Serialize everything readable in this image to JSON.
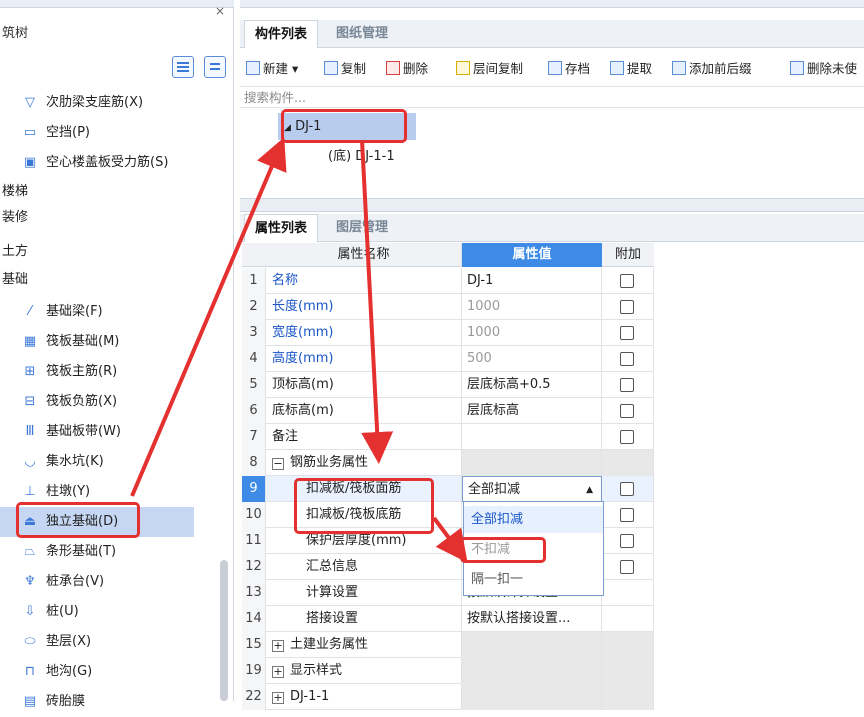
{
  "left_panel": {
    "title": "筑树",
    "items": [
      {
        "label": "次肋梁支座筋(X)",
        "icon": "rib-beam-support-icon"
      },
      {
        "label": "空挡(P)",
        "icon": "void-icon"
      },
      {
        "label": "空心楼盖板受力筋(S)",
        "icon": "hollow-slab-rebar-icon"
      }
    ],
    "categories": {
      "stairs": "楼梯",
      "decoration": "装修",
      "earthwork": "土方",
      "foundation": "基础"
    },
    "foundation_items": [
      {
        "label": "基础梁(F)",
        "icon": "foundation-beam-icon"
      },
      {
        "label": "筏板基础(M)",
        "icon": "raft-foundation-icon"
      },
      {
        "label": "筏板主筋(R)",
        "icon": "raft-main-rebar-icon"
      },
      {
        "label": "筏板负筋(X)",
        "icon": "raft-negative-rebar-icon"
      },
      {
        "label": "基础板带(W)",
        "icon": "foundation-strip-icon"
      },
      {
        "label": "集水坑(K)",
        "icon": "sump-pit-icon"
      },
      {
        "label": "柱墩(Y)",
        "icon": "column-pier-icon"
      },
      {
        "label": "独立基础(D)",
        "icon": "isolated-footing-icon"
      },
      {
        "label": "条形基础(T)",
        "icon": "strip-footing-icon"
      },
      {
        "label": "桩承台(V)",
        "icon": "pile-cap-icon"
      },
      {
        "label": "桩(U)",
        "icon": "pile-icon"
      },
      {
        "label": "垫层(X)",
        "icon": "cushion-layer-icon"
      },
      {
        "label": "地沟(G)",
        "icon": "trench-icon"
      },
      {
        "label": "砖胎膜",
        "icon": "brick-mould-icon"
      }
    ]
  },
  "component_panel": {
    "tabs": [
      "构件列表",
      "图纸管理"
    ],
    "toolbar": [
      "新建",
      "复制",
      "删除",
      "层间复制",
      "存档",
      "提取",
      "添加前后缀",
      "删除未使"
    ],
    "search_placeholder": "搜索构件...",
    "tree": {
      "root": "DJ-1",
      "child_prefix": "(底)",
      "child": "DJ-1-1"
    }
  },
  "property_panel": {
    "tabs": [
      "属性列表",
      "图层管理"
    ],
    "headers": {
      "name": "属性名称",
      "value": "属性值",
      "extra": "附加"
    },
    "rows": [
      {
        "num": "1",
        "name": "名称",
        "value": "DJ-1"
      },
      {
        "num": "2",
        "name": "长度(mm)",
        "value": "1000"
      },
      {
        "num": "3",
        "name": "宽度(mm)",
        "value": "1000"
      },
      {
        "num": "4",
        "name": "高度(mm)",
        "value": "500"
      },
      {
        "num": "5",
        "name": "顶标高(m)",
        "value": "层底标高+0.5"
      },
      {
        "num": "6",
        "name": "底标高(m)",
        "value": "层底标高"
      },
      {
        "num": "7",
        "name": "备注",
        "value": ""
      },
      {
        "num": "8",
        "name": "钢筋业务属性",
        "value": ""
      },
      {
        "num": "9",
        "name": "扣减板/筏板面筋",
        "value": "全部扣减"
      },
      {
        "num": "10",
        "name": "扣减板/筏板底筋",
        "value": ""
      },
      {
        "num": "11",
        "name": "保护层厚度(mm)",
        "value": ""
      },
      {
        "num": "12",
        "name": "汇总信息",
        "value": ""
      },
      {
        "num": "13",
        "name": "计算设置",
        "value": "按默认计算设置..."
      },
      {
        "num": "14",
        "name": "搭接设置",
        "value": "按默认搭接设置..."
      },
      {
        "num": "15",
        "name": "土建业务属性",
        "value": ""
      },
      {
        "num": "19",
        "name": "显示样式",
        "value": ""
      },
      {
        "num": "22",
        "name": "DJ-1-1",
        "value": ""
      }
    ],
    "dropdown_options": [
      "全部扣减",
      "不扣减",
      "隔一扣一"
    ]
  },
  "colors": {
    "accent": "#3d8be6",
    "annotation": "#e53030",
    "selection": "#c5d7f2"
  }
}
